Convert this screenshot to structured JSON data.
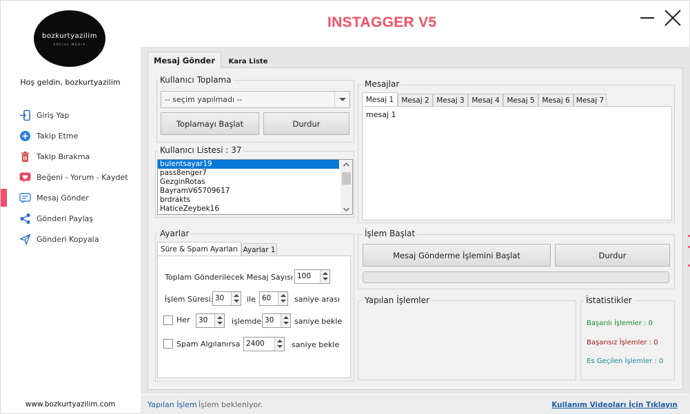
{
  "app": {
    "title": "INSTAGGER V5"
  },
  "brand": {
    "logo_text": "bozkurtyazilim",
    "logo_sub": "SOCIAL MEDIA",
    "welcome": "Hoş geldin, bozkurtyazilim",
    "website": "www.bozkurtyazilim.com"
  },
  "sidebar": {
    "items": [
      {
        "label": "Giriş Yap",
        "icon": "login-icon"
      },
      {
        "label": "Takip Etme",
        "icon": "plus-circle-icon"
      },
      {
        "label": "Takip Bırakma",
        "icon": "trash-icon"
      },
      {
        "label": "Beğeni - Yorum - Kaydet",
        "icon": "heart-icon"
      },
      {
        "label": "Mesaj Gönder",
        "icon": "message-icon",
        "active": true
      },
      {
        "label": "Gönderi Paylaş",
        "icon": "share-icon"
      },
      {
        "label": "Gönderi Kopyala",
        "icon": "send-icon"
      }
    ]
  },
  "tabs": {
    "active": "Mesaj Gönder",
    "other": "Kara Liste"
  },
  "collect": {
    "title": "Kullanıcı Toplama",
    "combo_value": "-- seçim yapılmadı --",
    "start_label": "Toplamayı Başlat",
    "stop_label": "Durdur"
  },
  "user_list": {
    "title": "Kullanıcı Listesi : 37",
    "items": [
      "bulentsayar19",
      "pass8enger7",
      "GezginRotas",
      "BayramV65709617",
      "brdrakts",
      "HaticeZeybek16"
    ],
    "selected_index": 0
  },
  "messages": {
    "title": "Mesajlar",
    "tabs": [
      "Mesaj 1",
      "Mesaj 2",
      "Mesaj 3",
      "Mesaj 4",
      "Mesaj 5",
      "Mesaj 6",
      "Mesaj 7"
    ],
    "active_tab": 0,
    "content": "mesaj 1"
  },
  "settings": {
    "title": "Ayarlar",
    "tabs": [
      "Süre & Spam Ayarları",
      "Ayarlar 1"
    ],
    "total_label": "Toplam Gönderilecek Mesaj Sayısı :",
    "total_value": "100",
    "duration_label": "İşlem Süresi:",
    "duration_from": "30",
    "duration_and": "ile",
    "duration_to": "60",
    "duration_suffix": "saniye arası",
    "every_label": "Her",
    "every_value": "30",
    "every_mid": "işlemde",
    "every_wait": "30",
    "every_suffix": "saniye bekle",
    "spam_label": "Spam Algılanırsa",
    "spam_value": "2400",
    "spam_suffix": "saniye bekle"
  },
  "process": {
    "title": "İşlem Başlat",
    "start_label": "Mesaj Gönderme İşlemini Başlat",
    "stop_label": "Durdur",
    "progress": 0
  },
  "done": {
    "title": "Yapılan İşlemler"
  },
  "stats": {
    "title": "İstatistikler",
    "success": "Başarılı İşlemler : 0",
    "fail": "Başarısız İşlemler : 0",
    "skipped": "Es Geçilen İşlemler : 0",
    "colors": {
      "success": "#1e8a2e",
      "fail": "#a11c1c",
      "skipped": "#1a8a9a"
    }
  },
  "status": {
    "label": "Yapılan İşlem",
    "colon": ":",
    "message": "İşlem bekleniyor.",
    "link": "Kullanım Videoları İçin Tıklayın"
  },
  "colors": {
    "accent": "#f24f63",
    "link": "#1f5fa8",
    "selection": "#0a78d7"
  }
}
